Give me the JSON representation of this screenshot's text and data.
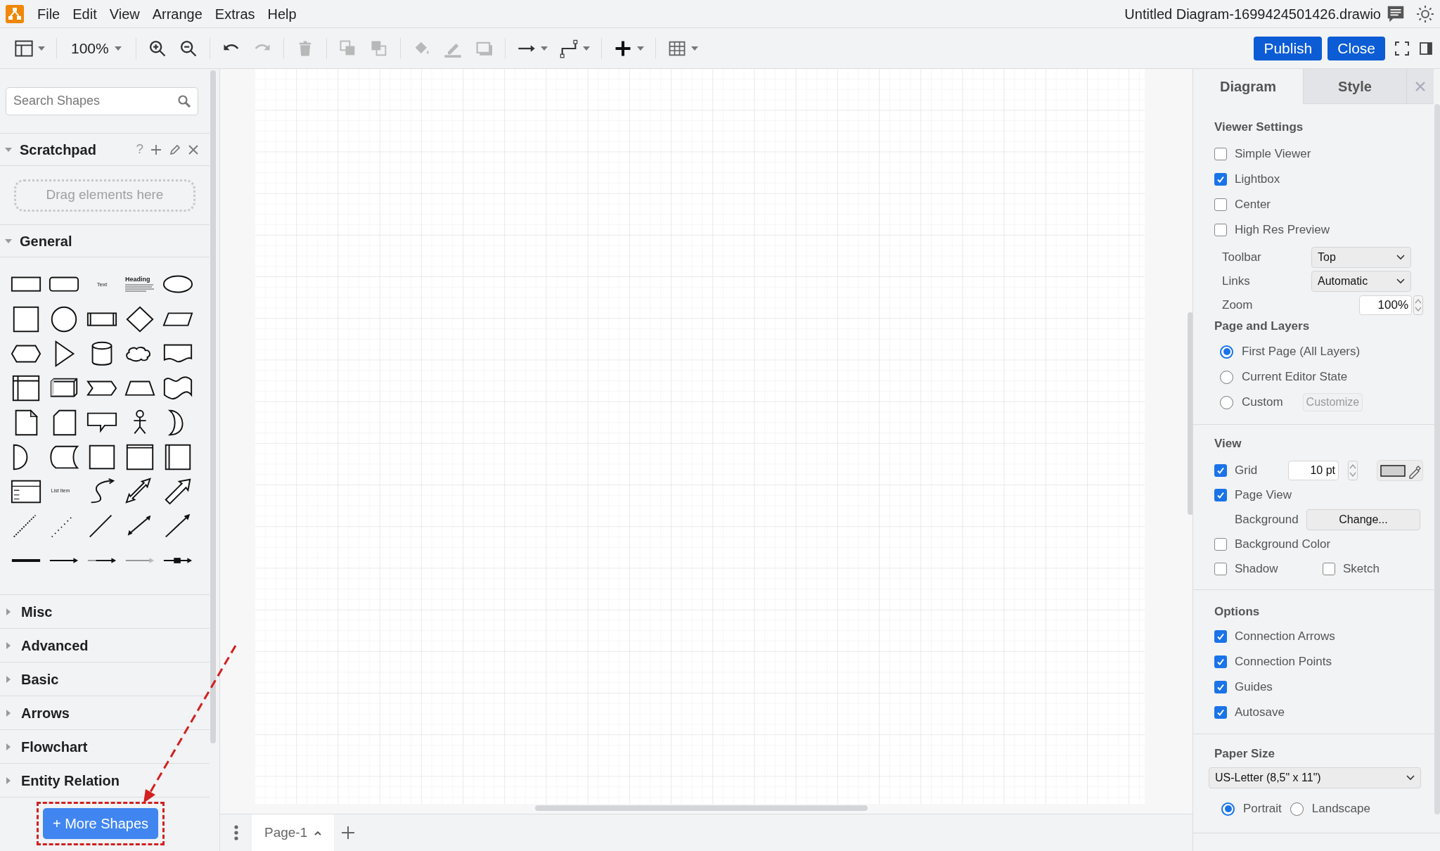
{
  "app": {
    "menu": [
      "File",
      "Edit",
      "View",
      "Arrange",
      "Extras",
      "Help"
    ],
    "document_title": "Untitled Diagram-1699424501426.drawio"
  },
  "toolbar": {
    "zoom": "100%",
    "publish": "Publish",
    "close": "Close"
  },
  "sidebar": {
    "search": {
      "placeholder": "Search Shapes"
    },
    "scratchpad": {
      "title": "Scratchpad",
      "expanded": true,
      "help": "?",
      "drop_hint": "Drag elements here"
    },
    "general": {
      "title": "General",
      "expanded": true,
      "shape_labels": [
        "Text",
        "Heading",
        "List Item"
      ]
    },
    "sections": [
      {
        "title": "Misc",
        "expanded": false
      },
      {
        "title": "Advanced",
        "expanded": false
      },
      {
        "title": "Basic",
        "expanded": false
      },
      {
        "title": "Arrows",
        "expanded": false
      },
      {
        "title": "Flowchart",
        "expanded": false
      },
      {
        "title": "Entity Relation",
        "expanded": false
      }
    ],
    "more_shapes": "+ More Shapes"
  },
  "page_tabs": [
    {
      "label": "Page-1",
      "selected": true
    }
  ],
  "format_panel": {
    "tabs": [
      {
        "label": "Diagram",
        "selected": true
      },
      {
        "label": "Style",
        "selected": false
      }
    ],
    "viewer_settings": {
      "title": "Viewer Settings",
      "options": [
        {
          "label": "Simple Viewer",
          "checked": false
        },
        {
          "label": "Lightbox",
          "checked": true
        },
        {
          "label": "Center",
          "checked": false
        },
        {
          "label": "High Res Preview",
          "checked": false
        }
      ],
      "toolbar": {
        "label": "Toolbar",
        "value": "Top"
      },
      "links": {
        "label": "Links",
        "value": "Automatic"
      },
      "zoom": {
        "label": "Zoom",
        "value": "100%"
      }
    },
    "page_and_layers": {
      "title": "Page and Layers",
      "options": [
        {
          "label": "First Page (All Layers)",
          "selected": true
        },
        {
          "label": "Current Editor State",
          "selected": false
        },
        {
          "label": "Custom",
          "selected": false
        }
      ],
      "customize": {
        "label": "Customize",
        "disabled": true
      }
    },
    "view": {
      "title": "View",
      "grid": {
        "label": "Grid",
        "checked": true,
        "size": "10 pt"
      },
      "page_view": {
        "label": "Page View",
        "checked": true
      },
      "background": {
        "label": "Background",
        "button": "Change..."
      },
      "background_color": {
        "label": "Background Color",
        "checked": false
      },
      "shadow": {
        "label": "Shadow",
        "checked": false
      },
      "sketch": {
        "label": "Sketch",
        "checked": false
      }
    },
    "options": {
      "title": "Options",
      "items": [
        {
          "label": "Connection Arrows",
          "checked": true
        },
        {
          "label": "Connection Points",
          "checked": true
        },
        {
          "label": "Guides",
          "checked": true
        },
        {
          "label": "Autosave",
          "checked": true
        }
      ]
    },
    "paper_size": {
      "title": "Paper Size",
      "value": "US-Letter (8,5\" x 11\")",
      "orientations": [
        {
          "label": "Portrait",
          "selected": true
        },
        {
          "label": "Landscape",
          "selected": false
        }
      ]
    }
  }
}
